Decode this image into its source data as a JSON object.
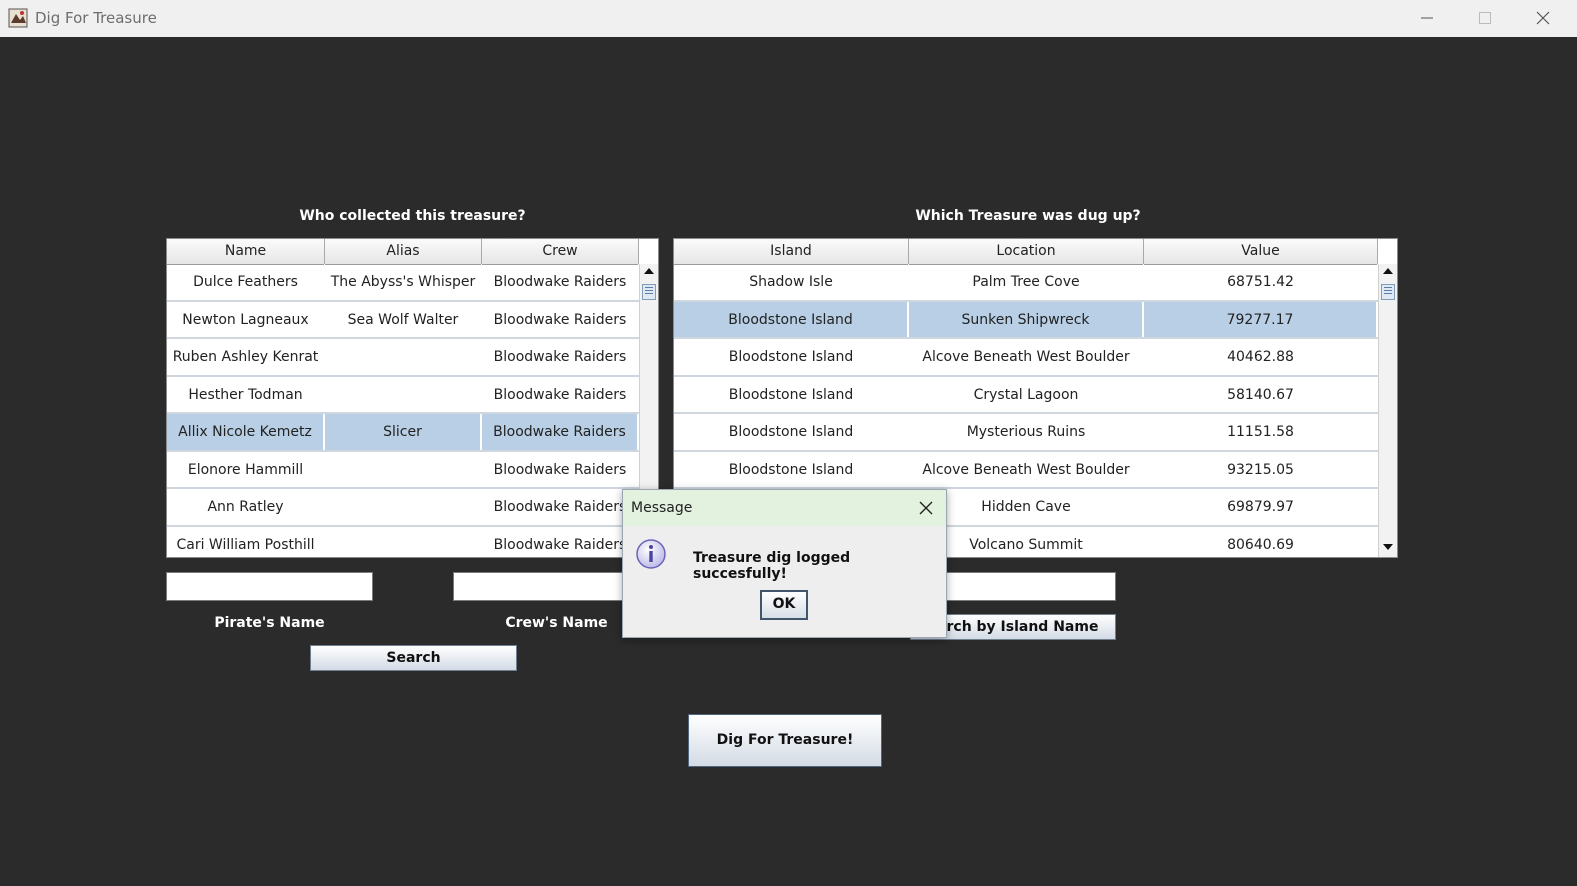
{
  "window": {
    "title": "Dig For Treasure",
    "icons": {
      "app": "treasure-map-app-icon",
      "minimize": "minimize-icon",
      "maximize": "maximize-icon",
      "close": "close-icon"
    }
  },
  "pirates": {
    "heading": "Who collected this treasure?",
    "columns": [
      "Name",
      "Alias",
      "Crew"
    ],
    "rows": [
      [
        "Dulce  Feathers",
        "The Abyss's Whisper",
        "Bloodwake Raiders"
      ],
      [
        "Newton  Lagneaux",
        "Sea Wolf Walter",
        "Bloodwake Raiders"
      ],
      [
        "Ruben Ashley Kenrat",
        "",
        "Bloodwake Raiders"
      ],
      [
        "Hesther  Todman",
        "",
        "Bloodwake Raiders"
      ],
      [
        "Allix Nicole Kemetz",
        "Slicer",
        "Bloodwake Raiders"
      ],
      [
        "Elonore  Hammill",
        "",
        "Bloodwake Raiders"
      ],
      [
        "Ann  Ratley",
        "",
        "Bloodwake Raiders"
      ],
      [
        "Cari William Posthill",
        "",
        "Bloodwake Raiders"
      ]
    ],
    "selected_row_index": 4
  },
  "treasures": {
    "heading": "Which Treasure was dug up?",
    "columns": [
      "Island",
      "Location",
      "Value"
    ],
    "rows": [
      [
        "Shadow Isle",
        "Palm Tree Cove",
        "68751.42"
      ],
      [
        "Bloodstone Island",
        "Sunken Shipwreck",
        "79277.17"
      ],
      [
        "Bloodstone Island",
        "Alcove Beneath West Boulder",
        "40462.88"
      ],
      [
        "Bloodstone Island",
        "Crystal Lagoon",
        "58140.67"
      ],
      [
        "Bloodstone Island",
        "Mysterious Ruins",
        "11151.58"
      ],
      [
        "Bloodstone Island",
        "Alcove Beneath West Boulder",
        "93215.05"
      ],
      [
        "",
        "Hidden Cave",
        "69879.97"
      ],
      [
        "",
        "Volcano Summit",
        "80640.69"
      ]
    ],
    "selected_row_index": 1
  },
  "search": {
    "pirate_name_label": "Pirate's Name",
    "pirate_name_value": "",
    "crew_name_label": "Crew's Name",
    "crew_name_value": "",
    "island_value": "",
    "search_button": "Search",
    "island_search_button": "earch by Island Name"
  },
  "dig_button": "Dig For Treasure!",
  "dialog": {
    "title": "Message",
    "message": "Treasure dig logged succesfully!",
    "ok_button": "OK",
    "icon": "info-icon"
  },
  "colors": {
    "background": "#2b2b2b",
    "selected_row": "#b8cfe5",
    "dialog_title_bar": "#e3f1df"
  }
}
